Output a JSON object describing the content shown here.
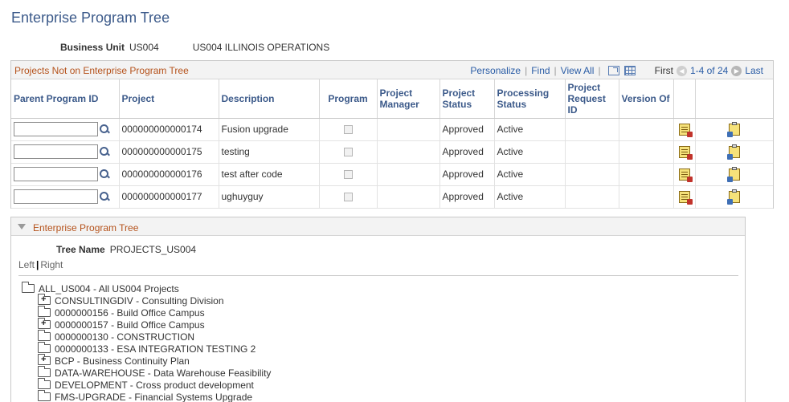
{
  "page_title": "Enterprise Program Tree",
  "business_unit": {
    "label": "Business Unit",
    "value": "US004",
    "description": "US004 ILLINOIS OPERATIONS"
  },
  "grid": {
    "title": "Projects Not on Enterprise Program Tree",
    "nav": {
      "personalize": "Personalize",
      "find": "Find",
      "view_all": "View All",
      "first": "First",
      "range": "1-4 of 24",
      "last": "Last"
    },
    "columns": {
      "parent_program_id": "Parent Program ID",
      "project": "Project",
      "description": "Description",
      "program": "Program",
      "project_manager": "Project Manager",
      "project_status": "Project Status",
      "processing_status": "Processing Status",
      "project_request_id": "Project Request ID",
      "version_of": "Version Of"
    },
    "rows": [
      {
        "parent_program_id": "",
        "project": "000000000000174",
        "description": "Fusion upgrade",
        "project_manager": "",
        "project_status": "Approved",
        "processing_status": "Active",
        "project_request_id": "",
        "version_of": ""
      },
      {
        "parent_program_id": "",
        "project": "000000000000175",
        "description": "testing",
        "project_manager": "",
        "project_status": "Approved",
        "processing_status": "Active",
        "project_request_id": "",
        "version_of": ""
      },
      {
        "parent_program_id": "",
        "project": "000000000000176",
        "description": "test after code",
        "project_manager": "",
        "project_status": "Approved",
        "processing_status": "Active",
        "project_request_id": "",
        "version_of": ""
      },
      {
        "parent_program_id": "",
        "project": "000000000000177",
        "description": "ughuyguy",
        "project_manager": "",
        "project_status": "Approved",
        "processing_status": "Active",
        "project_request_id": "",
        "version_of": ""
      }
    ]
  },
  "tree": {
    "section_title": "Enterprise Program Tree",
    "tree_name_label": "Tree Name",
    "tree_name_value": "PROJECTS_US004",
    "left": "Left",
    "right": "Right",
    "root": "ALL_US004 - All US004 Projects",
    "children": [
      {
        "label": "CONSULTINGDIV - Consulting Division",
        "expandable": true
      },
      {
        "label": "0000000156 - Build Office Campus",
        "expandable": false
      },
      {
        "label": "0000000157 - Build Office Campus",
        "expandable": true
      },
      {
        "label": "0000000130 - CONSTRUCTION",
        "expandable": false
      },
      {
        "label": "0000000133 - ESA INTEGRATION TESTING 2",
        "expandable": false
      },
      {
        "label": "BCP - Business Continuity Plan",
        "expandable": true
      },
      {
        "label": "DATA-WAREHOUSE - Data Warehouse Feasibility",
        "expandable": false
      },
      {
        "label": "DEVELOPMENT - Cross product development",
        "expandable": false
      },
      {
        "label": "FMS-UPGRADE - Financial Systems Upgrade",
        "expandable": false
      }
    ]
  }
}
